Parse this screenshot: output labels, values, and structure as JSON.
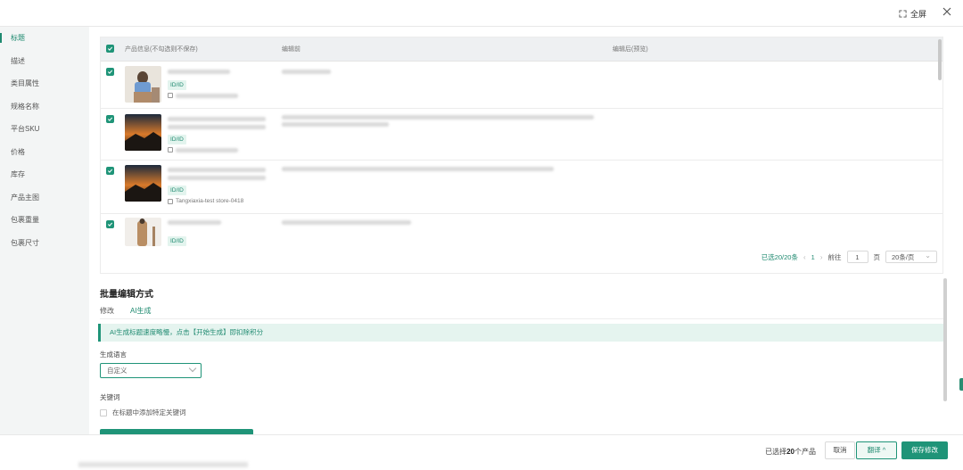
{
  "header": {
    "fullscreen_label": "全屏"
  },
  "sidebar": {
    "items": [
      {
        "label": "标题",
        "active": true
      },
      {
        "label": "描述"
      },
      {
        "label": "类目属性"
      },
      {
        "label": "规格名称"
      },
      {
        "label": "平台SKU"
      },
      {
        "label": "价格"
      },
      {
        "label": "库存"
      },
      {
        "label": "产品主图"
      },
      {
        "label": "包裹重量"
      },
      {
        "label": "包裹尺寸"
      }
    ]
  },
  "table": {
    "columns": [
      "产品信息(不勾选则不保存)",
      "编辑前",
      "编辑后(预览)"
    ],
    "rows": [
      {
        "tag": "ID/ID",
        "store": ""
      },
      {
        "tag": "ID/ID",
        "store": ""
      },
      {
        "tag": "ID/ID",
        "store": "Tangxiaxia-test store-0418"
      },
      {
        "tag": "ID/ID",
        "store": ""
      }
    ]
  },
  "pagination": {
    "selected_text": "已选20/20条",
    "current_page": "1",
    "goto_label": "前往",
    "goto_value": "1",
    "page_suffix": "页",
    "page_size": "20条/页"
  },
  "batch": {
    "title": "批量编辑方式",
    "tabs": [
      "修改",
      "AI生成"
    ],
    "active_tab": "AI生成",
    "notice": "AI生成标题速度略慢，点击【开始生成】即扣除积分",
    "language_label": "生成语言",
    "language_value": "自定义",
    "keyword_label": "关键词",
    "keyword_checkbox": "在标题中添加特定关键词"
  },
  "footer": {
    "selected_prefix": "已选择",
    "selected_count": "20",
    "selected_suffix": "个产品",
    "cancel": "取消",
    "translate": "翻译 ^",
    "save": "保存修改"
  },
  "colors": {
    "accent": "#1f9478",
    "accent_light": "#e5f4ef"
  }
}
